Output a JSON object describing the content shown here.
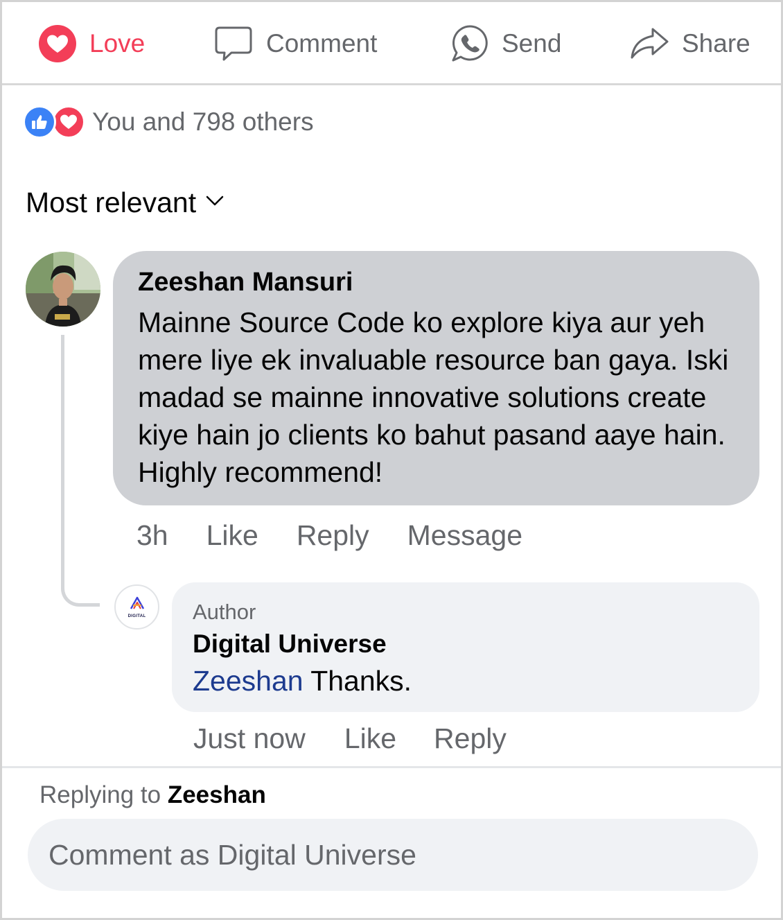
{
  "actions": {
    "love": {
      "label": "Love",
      "icon": "heart-icon",
      "color": "#f33e58"
    },
    "comment": {
      "label": "Comment",
      "icon": "speech-bubble-icon"
    },
    "send": {
      "label": "Send",
      "icon": "whatsapp-icon"
    },
    "share": {
      "label": "Share",
      "icon": "share-arrow-icon"
    }
  },
  "reactions": {
    "icons": [
      "like-icon",
      "love-icon"
    ],
    "summary": "You and 798 others"
  },
  "sort": {
    "label": "Most relevant",
    "icon": "chevron-down-icon"
  },
  "comment": {
    "author": "Zeeshan Mansuri",
    "text": "Mainne Source Code ko explore kiya aur yeh mere liye ek invaluable resource ban gaya. Iski madad se mainne innovative solutions create kiye hain jo clients ko bahut pasand aaye hain. Highly recommend!",
    "time": "3h",
    "like_label": "Like",
    "reply_label": "Reply",
    "message_label": "Message"
  },
  "reply": {
    "badge": "Author",
    "author": "Digital Universe",
    "logo_text": "DIGITAL",
    "mention": "Zeeshan",
    "text": " Thanks.",
    "time": "Just now",
    "like_label": "Like",
    "reply_label": "Reply"
  },
  "composer": {
    "replying_prefix": "Replying to ",
    "replying_name": "Zeeshan",
    "placeholder": "Comment as Digital Universe"
  },
  "colors": {
    "love": "#f33e58",
    "like": "#3b82f6",
    "mention": "#1d3b8f",
    "muted_text": "#65676b",
    "bubble_bg": "#ced0d4",
    "reply_bg": "#f0f2f5"
  }
}
